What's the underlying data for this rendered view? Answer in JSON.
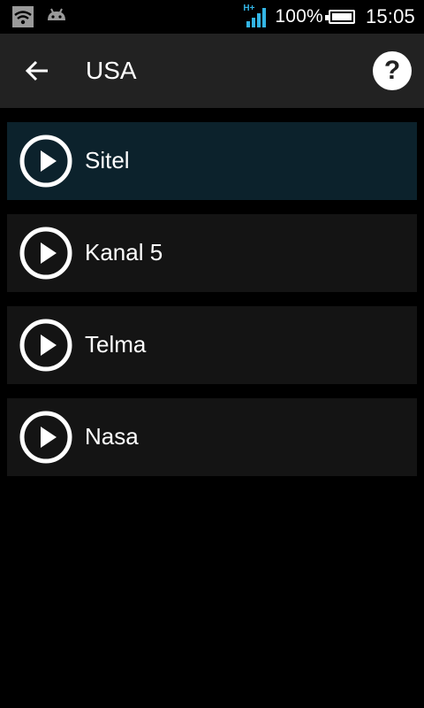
{
  "status_bar": {
    "network_type": "H+",
    "battery_percent": "100%",
    "time": "15:05",
    "icons": [
      "wifi-icon",
      "android-icon",
      "signal-icon",
      "battery-icon"
    ],
    "accent_color": "#33b5e5"
  },
  "action_bar": {
    "title": "USA",
    "back_icon": "arrow-left-icon",
    "help_icon": "help-icon"
  },
  "channels": [
    {
      "label": "Sitel",
      "selected": true
    },
    {
      "label": "Kanal 5",
      "selected": false
    },
    {
      "label": "Telma",
      "selected": false
    },
    {
      "label": "Nasa",
      "selected": false
    }
  ],
  "colors": {
    "background": "#000000",
    "action_bar": "#222222",
    "item": "#141414",
    "item_selected": "#0c222c"
  }
}
